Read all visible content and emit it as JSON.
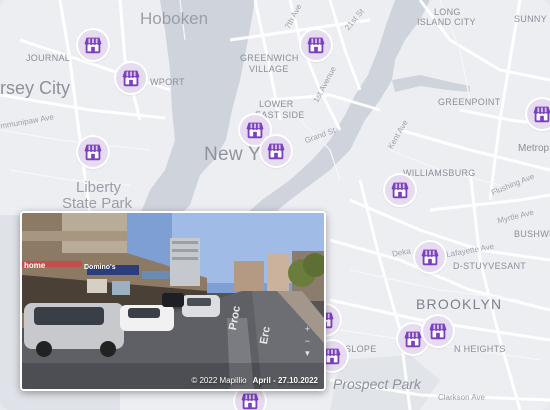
{
  "map": {
    "places": {
      "hoboken": "Hoboken",
      "journal_square": "JOURNAL",
      "jersey_city": "rsey City",
      "newport": "WPORT",
      "greenwich_village": "GREENWICH",
      "greenwich_village_2": "VILLAGE",
      "lower_east_side": "LOWER",
      "lower_east_side_2": "EAST SIDE",
      "new_york": "New York",
      "long_island_city": "LONG",
      "long_island_city_2": "ISLAND CITY",
      "sunnyside": "SUNNY",
      "greenpoint": "GREENPOINT",
      "williamsburg": "WILLIAMSBURG",
      "liberty_state_park": "Liberty",
      "liberty_state_park_2": "State Park",
      "bed_stuy": "D-STUYVESANT",
      "brooklyn": "BROOKLYN",
      "crown_heights": "N HEIGHTS",
      "park_slope": "SLOPE",
      "prospect_park": "Prospect Park",
      "metropolitan": "Metrop",
      "bushwick": "BUSHWI"
    },
    "streets": {
      "s7th": "7th Ave",
      "s1st": "1st Avenue",
      "s21st": "21st St",
      "grand": "Grand St",
      "kent": "Kent Ave",
      "flushing": "Flushing Ave",
      "myrtle": "Myrtle Ave",
      "lafayette": "Lafayette Ave",
      "dekalb": "Deka",
      "clarkson": "Clarkson Ave",
      "communipaw": "mmunipaw Ave"
    },
    "marker_icon": "storefront-icon",
    "marker_color": "#7b3fbf"
  },
  "photo_preview": {
    "copyright": "© 2022 Mapillio",
    "date": "April - 27.10.2022",
    "shop_sign": "Domino's",
    "sign_left": "home",
    "road_text_1": "Proc",
    "road_text_2": "Erc"
  }
}
